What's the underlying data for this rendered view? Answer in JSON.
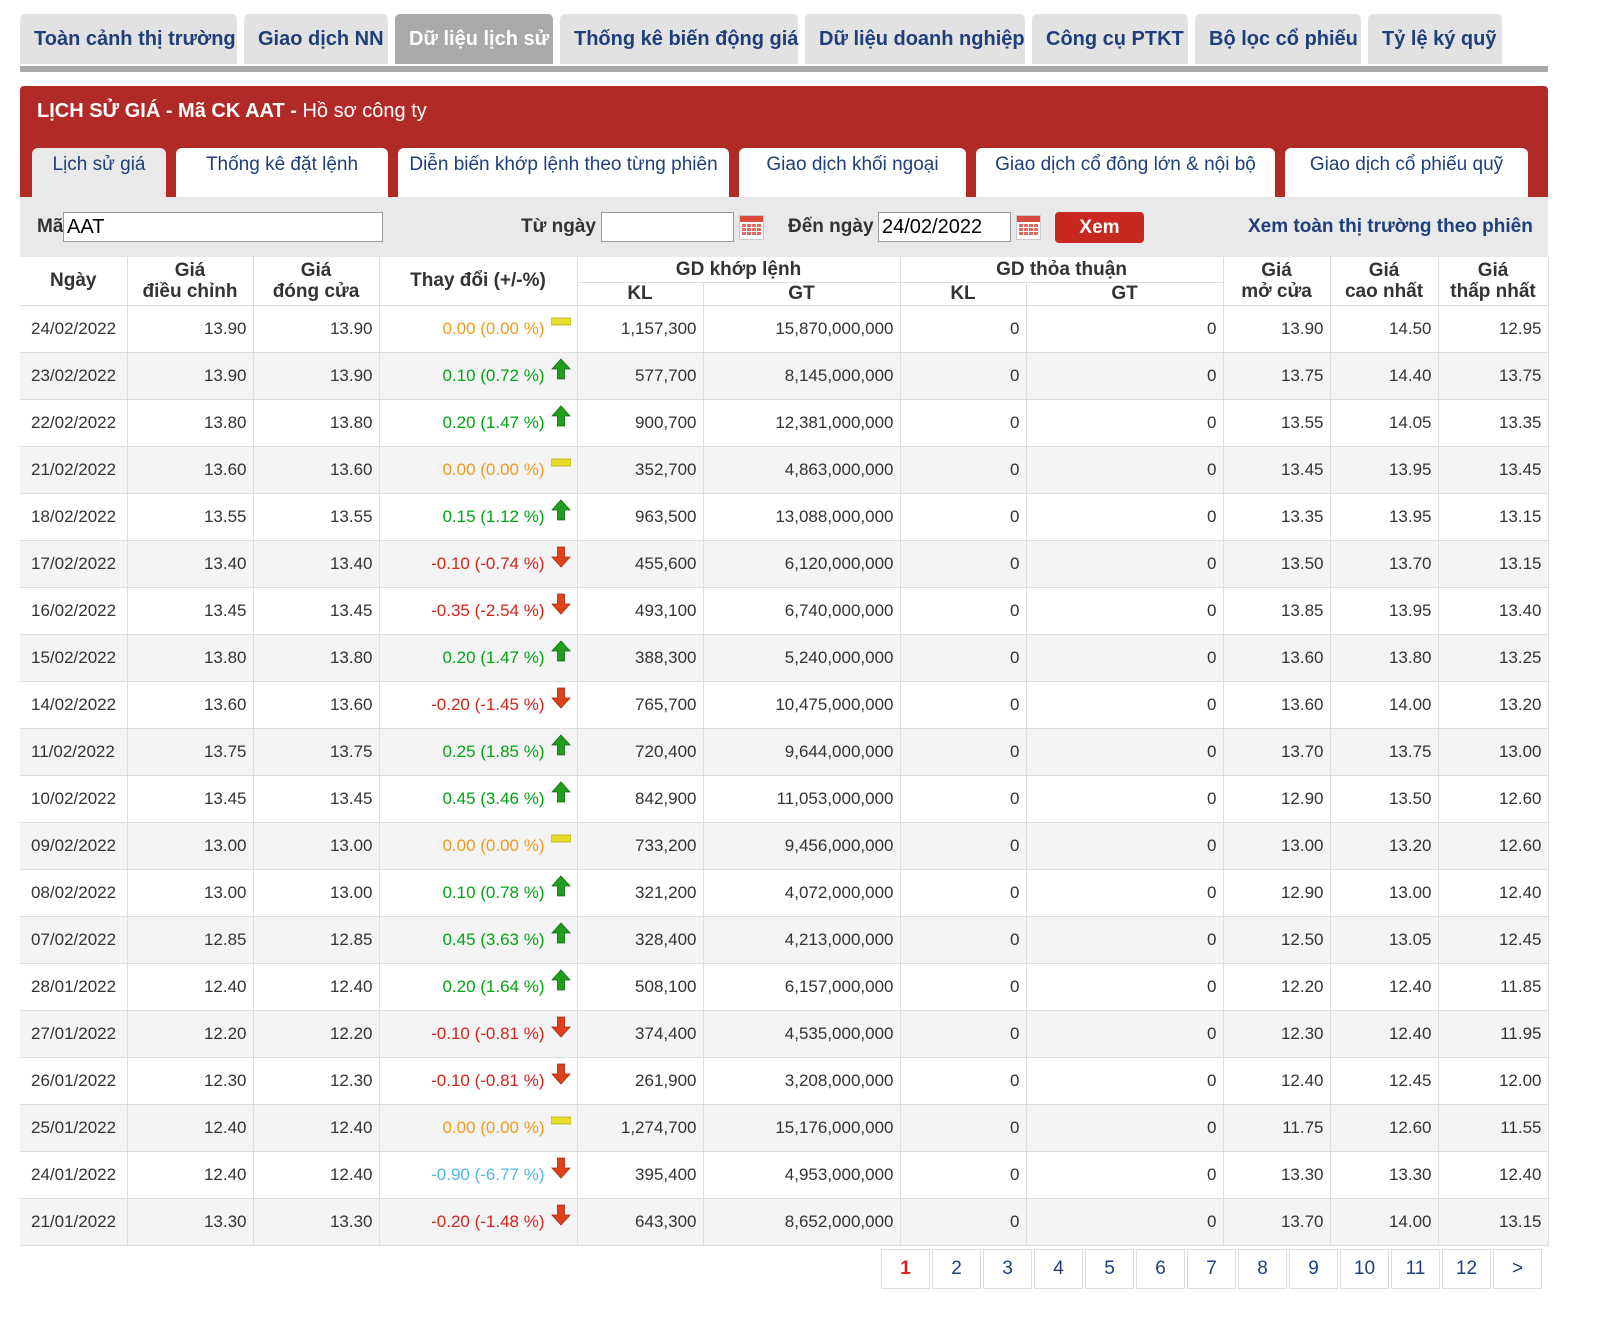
{
  "topnav": {
    "tabs": [
      "Toàn cảnh thị trường",
      "Giao dịch NN",
      "Dữ liệu lịch sử",
      "Thống kê biến động giá",
      "Dữ liệu doanh nghiệp",
      "Công cụ PTKT",
      "Bộ lọc cổ phiếu",
      "Tỷ lệ ký quỹ"
    ],
    "active_index": 2
  },
  "panel": {
    "title_bold": "LỊCH SỬ GIÁ - Mã CK AAT -",
    "title_link": "Hồ sơ công ty",
    "subtabs": [
      "Lịch sử giá",
      "Thống kê đặt lệnh",
      "Diễn biến khớp lệnh theo từng phiên",
      "Giao dịch khối ngoại",
      "Giao dịch cổ đông lớn & nội bộ",
      "Giao dịch cổ phiếu quỹ"
    ],
    "active_subtab": 0
  },
  "filter": {
    "ma_label": "Mã",
    "ma_value": "AAT",
    "from_label": "Từ ngày",
    "from_value": "",
    "to_label": "Đến ngày",
    "to_value": "24/02/2022",
    "submit_label": "Xem",
    "market_link": "Xem toàn thị trường theo phiên"
  },
  "table": {
    "headers": {
      "date": "Ngày",
      "adj_l1": "Giá",
      "adj_l2": "điều chỉnh",
      "close_l1": "Giá",
      "close_l2": "đóng cửa",
      "change": "Thay đổi (+/-%)",
      "matched": "GD khớp lệnh",
      "negotiated": "GD thỏa thuận",
      "kl": "KL",
      "gt": "GT",
      "open_l1": "Giá",
      "open_l2": "mở cửa",
      "high_l1": "Giá",
      "high_l2": "cao nhất",
      "low_l1": "Giá",
      "low_l2": "thấp nhất"
    },
    "rows": [
      {
        "date": "24/02/2022",
        "adj": "13.90",
        "close": "13.90",
        "change": "0.00 (0.00 %)",
        "trend": "ref",
        "kl": "1,157,300",
        "gt": "15,870,000,000",
        "tt_kl": "0",
        "tt_gt": "0",
        "open": "13.90",
        "high": "14.50",
        "low": "12.95"
      },
      {
        "date": "23/02/2022",
        "adj": "13.90",
        "close": "13.90",
        "change": "0.10 (0.72 %)",
        "trend": "up",
        "kl": "577,700",
        "gt": "8,145,000,000",
        "tt_kl": "0",
        "tt_gt": "0",
        "open": "13.75",
        "high": "14.40",
        "low": "13.75"
      },
      {
        "date": "22/02/2022",
        "adj": "13.80",
        "close": "13.80",
        "change": "0.20 (1.47 %)",
        "trend": "up",
        "kl": "900,700",
        "gt": "12,381,000,000",
        "tt_kl": "0",
        "tt_gt": "0",
        "open": "13.55",
        "high": "14.05",
        "low": "13.35"
      },
      {
        "date": "21/02/2022",
        "adj": "13.60",
        "close": "13.60",
        "change": "0.00 (0.00 %)",
        "trend": "ref",
        "kl": "352,700",
        "gt": "4,863,000,000",
        "tt_kl": "0",
        "tt_gt": "0",
        "open": "13.45",
        "high": "13.95",
        "low": "13.45"
      },
      {
        "date": "18/02/2022",
        "adj": "13.55",
        "close": "13.55",
        "change": "0.15 (1.12 %)",
        "trend": "up",
        "kl": "963,500",
        "gt": "13,088,000,000",
        "tt_kl": "0",
        "tt_gt": "0",
        "open": "13.35",
        "high": "13.95",
        "low": "13.15"
      },
      {
        "date": "17/02/2022",
        "adj": "13.40",
        "close": "13.40",
        "change": "-0.10 (-0.74 %)",
        "trend": "down",
        "kl": "455,600",
        "gt": "6,120,000,000",
        "tt_kl": "0",
        "tt_gt": "0",
        "open": "13.50",
        "high": "13.70",
        "low": "13.15"
      },
      {
        "date": "16/02/2022",
        "adj": "13.45",
        "close": "13.45",
        "change": "-0.35 (-2.54 %)",
        "trend": "down",
        "kl": "493,100",
        "gt": "6,740,000,000",
        "tt_kl": "0",
        "tt_gt": "0",
        "open": "13.85",
        "high": "13.95",
        "low": "13.40"
      },
      {
        "date": "15/02/2022",
        "adj": "13.80",
        "close": "13.80",
        "change": "0.20 (1.47 %)",
        "trend": "up",
        "kl": "388,300",
        "gt": "5,240,000,000",
        "tt_kl": "0",
        "tt_gt": "0",
        "open": "13.60",
        "high": "13.80",
        "low": "13.25"
      },
      {
        "date": "14/02/2022",
        "adj": "13.60",
        "close": "13.60",
        "change": "-0.20 (-1.45 %)",
        "trend": "down",
        "kl": "765,700",
        "gt": "10,475,000,000",
        "tt_kl": "0",
        "tt_gt": "0",
        "open": "13.60",
        "high": "14.00",
        "low": "13.20"
      },
      {
        "date": "11/02/2022",
        "adj": "13.75",
        "close": "13.75",
        "change": "0.25 (1.85 %)",
        "trend": "up",
        "kl": "720,400",
        "gt": "9,644,000,000",
        "tt_kl": "0",
        "tt_gt": "0",
        "open": "13.70",
        "high": "13.75",
        "low": "13.00"
      },
      {
        "date": "10/02/2022",
        "adj": "13.45",
        "close": "13.45",
        "change": "0.45 (3.46 %)",
        "trend": "up",
        "kl": "842,900",
        "gt": "11,053,000,000",
        "tt_kl": "0",
        "tt_gt": "0",
        "open": "12.90",
        "high": "13.50",
        "low": "12.60"
      },
      {
        "date": "09/02/2022",
        "adj": "13.00",
        "close": "13.00",
        "change": "0.00 (0.00 %)",
        "trend": "ref",
        "kl": "733,200",
        "gt": "9,456,000,000",
        "tt_kl": "0",
        "tt_gt": "0",
        "open": "13.00",
        "high": "13.20",
        "low": "12.60"
      },
      {
        "date": "08/02/2022",
        "adj": "13.00",
        "close": "13.00",
        "change": "0.10 (0.78 %)",
        "trend": "up",
        "kl": "321,200",
        "gt": "4,072,000,000",
        "tt_kl": "0",
        "tt_gt": "0",
        "open": "12.90",
        "high": "13.00",
        "low": "12.40"
      },
      {
        "date": "07/02/2022",
        "adj": "12.85",
        "close": "12.85",
        "change": "0.45 (3.63 %)",
        "trend": "up",
        "kl": "328,400",
        "gt": "4,213,000,000",
        "tt_kl": "0",
        "tt_gt": "0",
        "open": "12.50",
        "high": "13.05",
        "low": "12.45"
      },
      {
        "date": "28/01/2022",
        "adj": "12.40",
        "close": "12.40",
        "change": "0.20 (1.64 %)",
        "trend": "up",
        "kl": "508,100",
        "gt": "6,157,000,000",
        "tt_kl": "0",
        "tt_gt": "0",
        "open": "12.20",
        "high": "12.40",
        "low": "11.85"
      },
      {
        "date": "27/01/2022",
        "adj": "12.20",
        "close": "12.20",
        "change": "-0.10 (-0.81 %)",
        "trend": "down",
        "kl": "374,400",
        "gt": "4,535,000,000",
        "tt_kl": "0",
        "tt_gt": "0",
        "open": "12.30",
        "high": "12.40",
        "low": "11.95"
      },
      {
        "date": "26/01/2022",
        "adj": "12.30",
        "close": "12.30",
        "change": "-0.10 (-0.81 %)",
        "trend": "down",
        "kl": "261,900",
        "gt": "3,208,000,000",
        "tt_kl": "0",
        "tt_gt": "0",
        "open": "12.40",
        "high": "12.45",
        "low": "12.00"
      },
      {
        "date": "25/01/2022",
        "adj": "12.40",
        "close": "12.40",
        "change": "0.00 (0.00 %)",
        "trend": "ref",
        "kl": "1,274,700",
        "gt": "15,176,000,000",
        "tt_kl": "0",
        "tt_gt": "0",
        "open": "11.75",
        "high": "12.60",
        "low": "11.55"
      },
      {
        "date": "24/01/2022",
        "adj": "12.40",
        "close": "12.40",
        "change": "-0.90 (-6.77 %)",
        "trend": "floor",
        "kl": "395,400",
        "gt": "4,953,000,000",
        "tt_kl": "0",
        "tt_gt": "0",
        "open": "13.30",
        "high": "13.30",
        "low": "12.40"
      },
      {
        "date": "21/01/2022",
        "adj": "13.30",
        "close": "13.30",
        "change": "-0.20 (-1.48 %)",
        "trend": "down",
        "kl": "643,300",
        "gt": "8,652,000,000",
        "tt_kl": "0",
        "tt_gt": "0",
        "open": "13.70",
        "high": "14.00",
        "low": "13.15"
      }
    ]
  },
  "trend_icons": {
    "up": "green-up-arrow-icon",
    "down": "red-down-arrow-icon",
    "ref": "yellow-bar-icon",
    "floor": "red-down-arrow-icon"
  },
  "colors": {
    "up": "#00a514",
    "down": "#d5231b",
    "ref": "#f29a1b",
    "floor": "#4fb6e8",
    "brand_red": "#b22a25",
    "nav_text": "#1e3f7a"
  },
  "pagination": {
    "pages": [
      "1",
      "2",
      "3",
      "4",
      "5",
      "6",
      "7",
      "8",
      "9",
      "10",
      "11",
      "12"
    ],
    "next": ">",
    "current": "1"
  }
}
